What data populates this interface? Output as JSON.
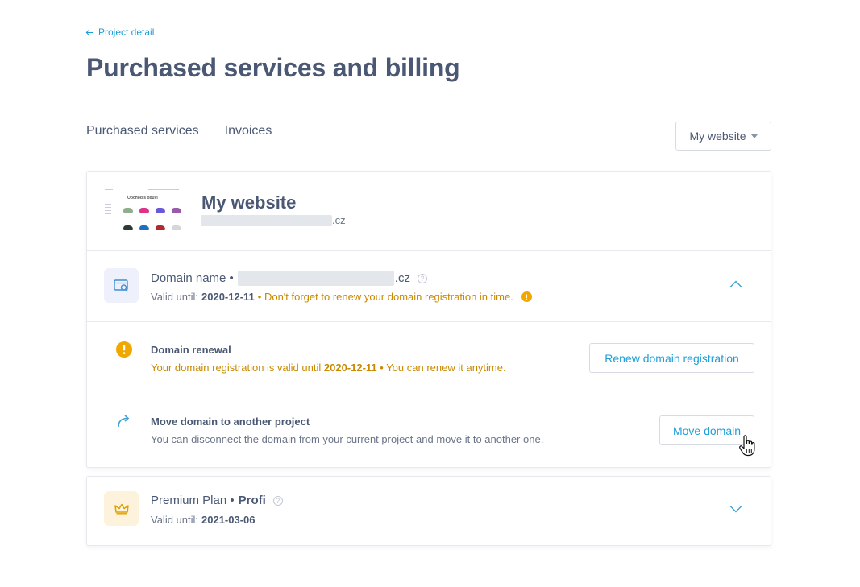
{
  "nav": {
    "back_label": "Project detail"
  },
  "page": {
    "title": "Purchased services and billing"
  },
  "tabs": [
    {
      "label": "Purchased services",
      "active": true
    },
    {
      "label": "Invoices",
      "active": false
    }
  ],
  "project_select": {
    "value": "My website"
  },
  "site": {
    "name": "My website",
    "url_suffix": ".cz",
    "thumb_title": "Obchod s obuví"
  },
  "domain": {
    "title": "Domain name •",
    "name_suffix": ".cz",
    "valid_label": "Valid until:",
    "valid_date": "2020-12-11",
    "warning": "• Don't forget to renew your domain registration in time.",
    "icon": "domain-search-icon"
  },
  "renewal": {
    "title": "Domain renewal",
    "text_before": "Your domain registration is valid until",
    "date": "2020-12-11",
    "text_after": "• You can renew it anytime.",
    "button": "Renew domain registration"
  },
  "move": {
    "title": "Move domain to another project",
    "text": "You can disconnect the domain from your current project and move it to another one.",
    "button": "Move domain"
  },
  "plan": {
    "title": "Premium Plan •",
    "plan_name": "Profi",
    "valid_label": "Valid until:",
    "valid_date": "2021-03-06",
    "icon": "crown-icon"
  },
  "colors": {
    "accent": "#1e9fd7",
    "warning": "#c98a00",
    "title": "#4a5873"
  }
}
